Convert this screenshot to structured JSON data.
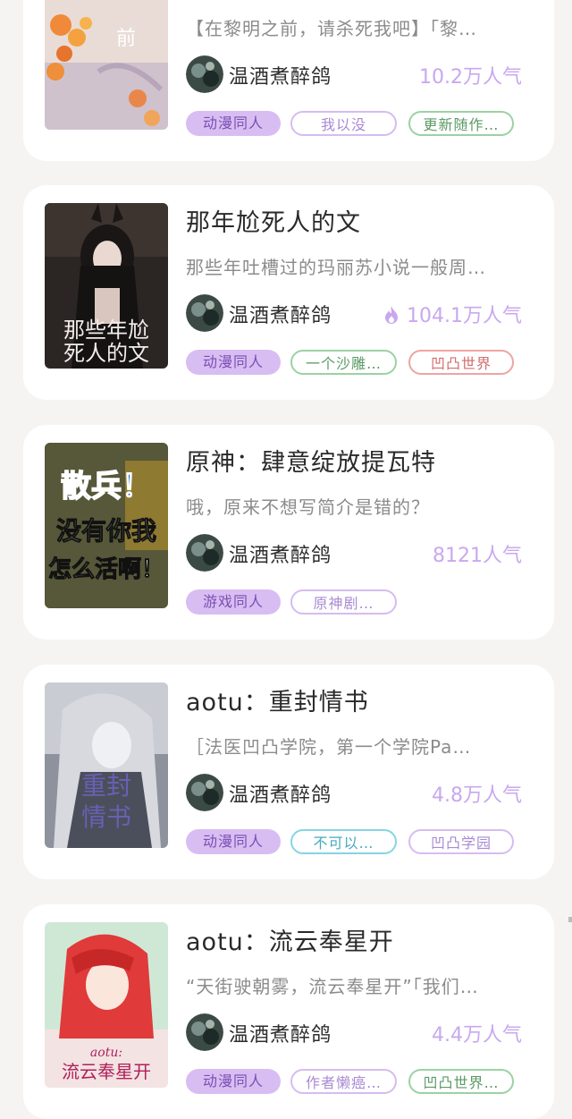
{
  "cards": [
    {
      "title": "",
      "desc": "【在黎明之前，请杀死我吧】「黎…",
      "author": "温酒煮醉鸽",
      "popularity": "10.2万人气",
      "hot": false,
      "tags": [
        "动漫同人",
        "我以没",
        "更新随作…"
      ],
      "cover_text": "前",
      "cover_icon": "autumn-flowers-cover"
    },
    {
      "title": "那年尬死人的文",
      "desc": "那些年吐槽过的玛丽苏小说一般周…",
      "author": "温酒煮醉鸽",
      "popularity": "104.1万人气",
      "hot": true,
      "tags": [
        "动漫同人",
        "一个沙雕…",
        "凹凸世界"
      ],
      "cover_text": "那些年尬死人的文",
      "cover_icon": "dark-anime-girl-cover"
    },
    {
      "title": "原神：肆意绽放提瓦特",
      "desc": "哦，原来不想写简介是错的？",
      "author": "温酒煮醉鸽",
      "popularity": "8121人气",
      "hot": false,
      "tags": [
        "游戏同人",
        "原神剧…"
      ],
      "cover_text_line1": "散兵！",
      "cover_text_line2": "没有你我",
      "cover_text_line3": "怎么活啊！",
      "cover_icon": "meme-text-cover"
    },
    {
      "title": "aotu：重封情书",
      "desc": "［法医凹凸学院，第一个学院Pa…",
      "author": "温酒煮醉鸽",
      "popularity": "4.8万人气",
      "hot": false,
      "tags": [
        "动漫同人",
        "不可以…",
        "凹凸学园"
      ],
      "cover_text": "重封情书",
      "cover_icon": "silver-hair-anime-cover"
    },
    {
      "title": "aotu：流云奉星开",
      "desc": "“天街驶朝雾，流云奉星开”「我们…",
      "author": "温酒煮醉鸽",
      "popularity": "4.4万人气",
      "hot": false,
      "tags": [
        "动漫同人",
        "作者懒癌…",
        "凹凸世界…"
      ],
      "cover_text": "aotu: 流云奉星开",
      "cover_icon": "red-hair-anime-cover"
    }
  ],
  "colors": {
    "popularity": "#c9a8ee",
    "tag_fill": "#d8bdf2",
    "tag_purple": "#d6bcf0",
    "tag_green": "#9cd1a4",
    "tag_red": "#eea4a4",
    "tag_cyan": "#86d4e3",
    "hot_flame": "#c9a8ee"
  }
}
